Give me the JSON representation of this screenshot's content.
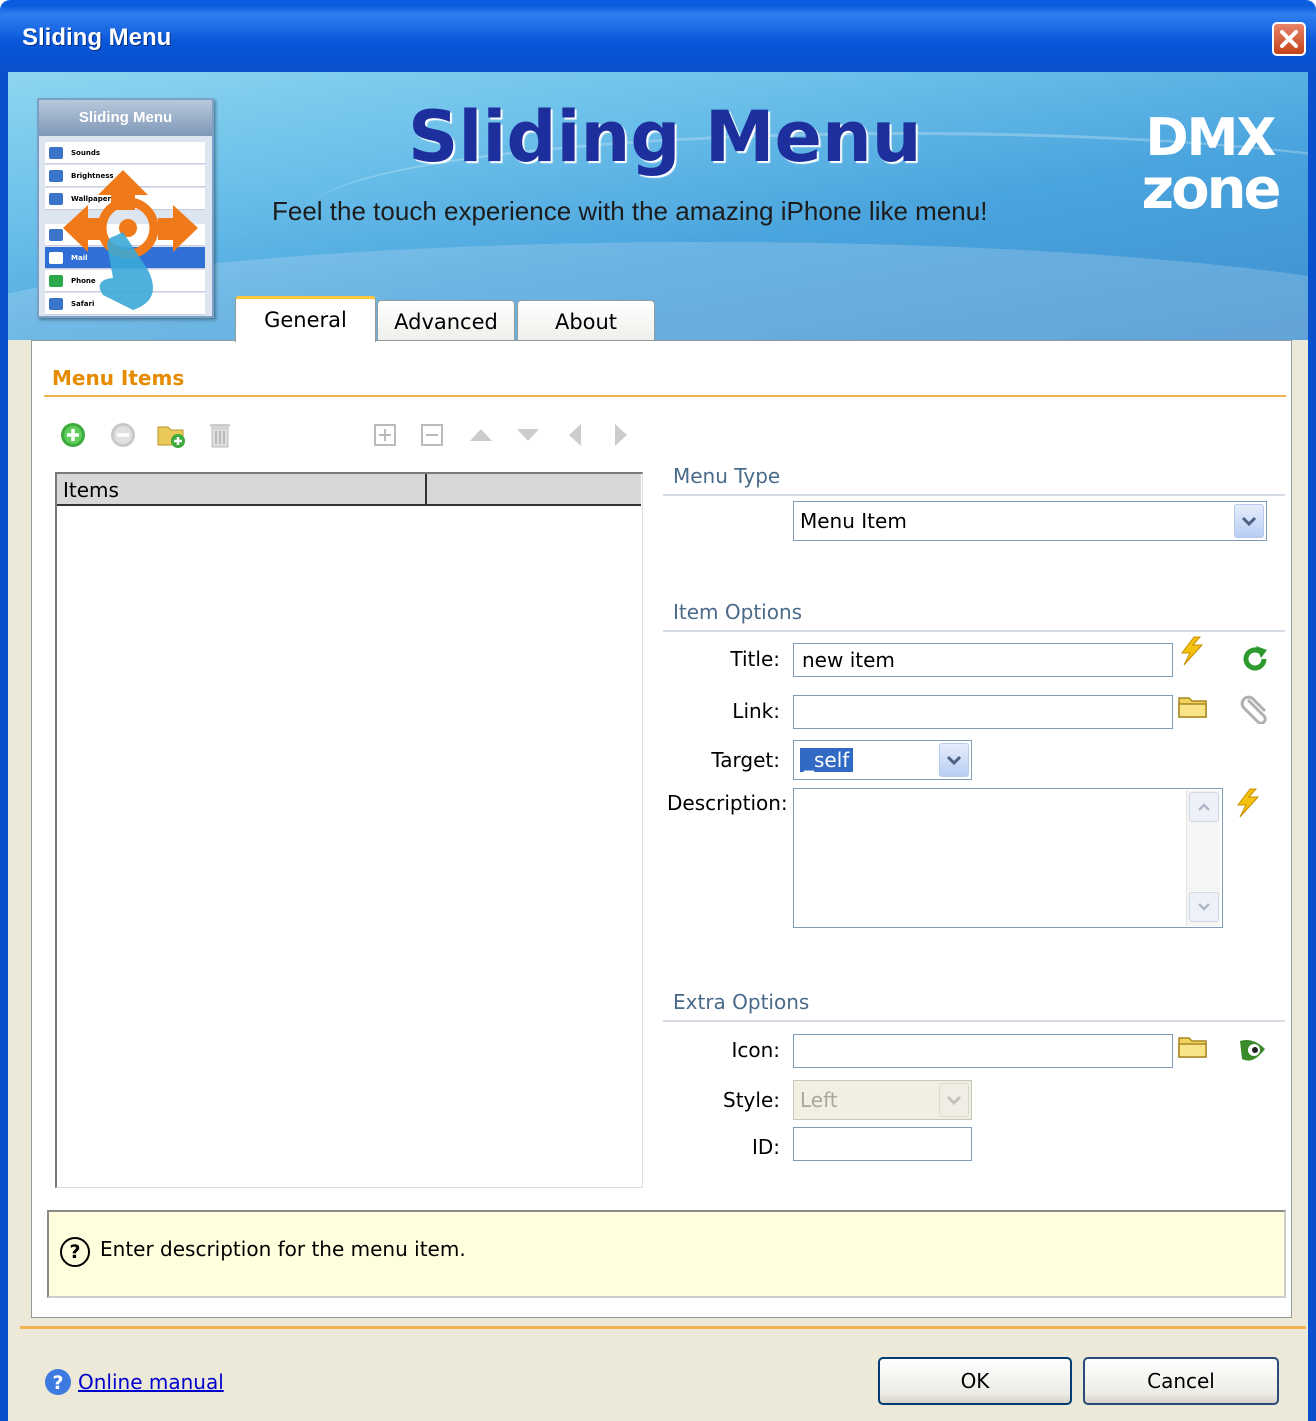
{
  "window": {
    "title": "Sliding Menu"
  },
  "banner": {
    "title": "Sliding Menu",
    "subtitle": "Feel the touch experience with the amazing iPhone like menu!",
    "brand_top": "DMX",
    "brand_bottom": "zone",
    "thumb_title": "Sliding Menu",
    "thumb_items": [
      "Sounds",
      "Brightness",
      "Wallpaper",
      "",
      "Mail",
      "Phone",
      "Safari"
    ]
  },
  "tabs": [
    {
      "label": "General",
      "active": true
    },
    {
      "label": "Advanced",
      "active": false
    },
    {
      "label": "About",
      "active": false
    }
  ],
  "section": {
    "title": "Menu Items"
  },
  "list": {
    "column_header": "Items"
  },
  "menu_type": {
    "group_label": "Menu Type",
    "value": "Menu Item"
  },
  "item_options": {
    "group_label": "Item Options",
    "title_label": "Title:",
    "title_value": "new item",
    "link_label": "Link:",
    "link_value": "",
    "target_label": "Target:",
    "target_value": "_self",
    "description_label": "Description:",
    "description_value": ""
  },
  "extra_options": {
    "group_label": "Extra Options",
    "icon_label": "Icon:",
    "icon_value": "",
    "style_label": "Style:",
    "style_value": "Left",
    "id_label": "ID:",
    "id_value": ""
  },
  "help": {
    "text": "Enter description for the menu item.",
    "icon": "question-icon"
  },
  "footer": {
    "manual_link": "Online manual",
    "ok_label": "OK",
    "cancel_label": "Cancel"
  },
  "colors": {
    "accent": "#f4b350",
    "section_title": "#e68a00",
    "titlebar": "#0a5de0",
    "help_bg": "#ffffdd"
  }
}
